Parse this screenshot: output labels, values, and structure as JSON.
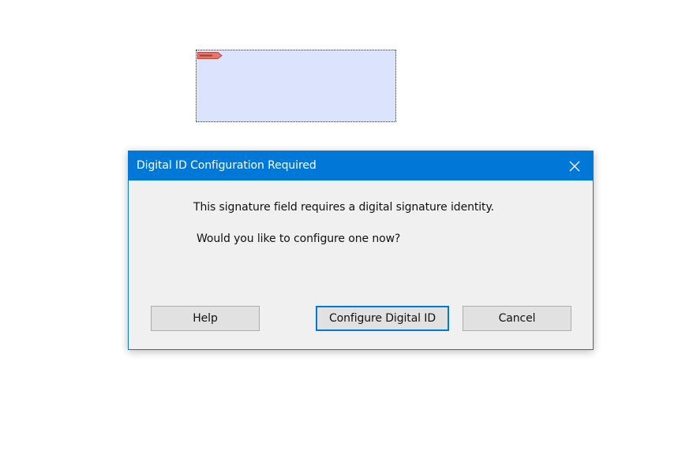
{
  "document": {
    "signature_field": {
      "flag_icon": "signature-flag-icon",
      "fill_color": "#dce3fd",
      "flag_color": "#e8736b"
    }
  },
  "dialog": {
    "title": "Digital ID Configuration Required",
    "close_icon": "close-icon",
    "message_line1": "This signature field requires a digital signature identity.",
    "message_line2": "Would you like to configure one now?",
    "buttons": {
      "help": "Help",
      "configure": "Configure Digital ID",
      "cancel": "Cancel"
    },
    "accent_color": "#0078d7"
  }
}
